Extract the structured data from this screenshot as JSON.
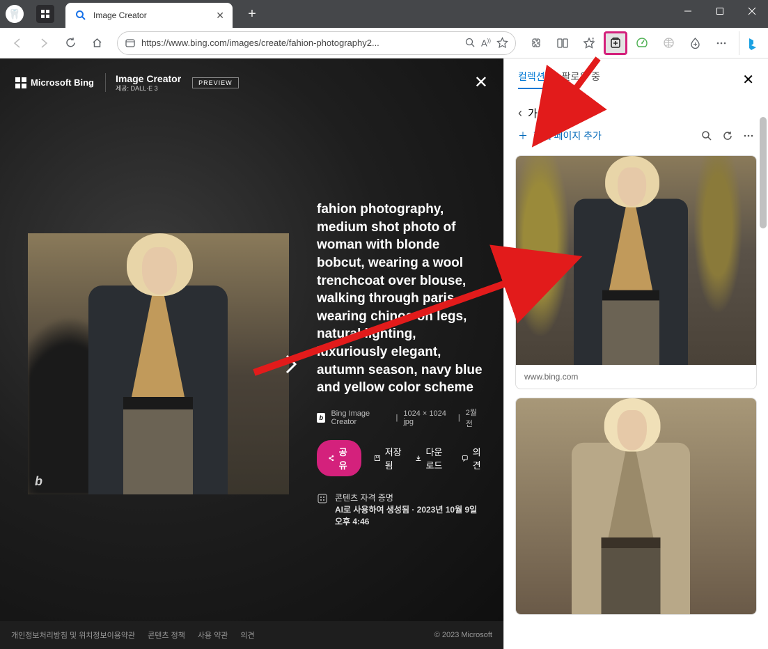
{
  "window": {
    "tab_title": "Image Creator",
    "url": "https://www.bing.com/images/create/fahion-photography2..."
  },
  "creator": {
    "brand_ms": "Microsoft Bing",
    "brand_ic": "Image Creator",
    "brand_sub": "제공: DALL·E 3",
    "preview_badge": "PREVIEW",
    "prompt": "fahion photography, medium shot photo of woman with blonde bobcut, wearing a wool trenchcoat over blouse, walking through paris, wearing chinos on legs, natural lighting, luxuriously elegant, autumn season, navy blue and yellow color scheme",
    "source": "Bing Image Creator",
    "dimensions": "1024 × 1024 jpg",
    "age": "2월 전",
    "share": "공유",
    "save": "저장됨",
    "download": "다운로드",
    "feedback": "의견",
    "credential1": "콘텐츠 자격 증명",
    "credential2": "AI로 사용하여 생성됨 · 2023년 10월 9일 오후 4:46",
    "footer_privacy": "개인정보처리방침 및 위치정보이용약관",
    "footer_content": "콘텐츠 정책",
    "footer_terms": "사용 약관",
    "footer_feedback": "의견",
    "footer_copyright": "© 2023 Microsoft"
  },
  "collections": {
    "tab_collections": "컬렉션",
    "tab_following": "팔로우 중",
    "title": "가을 패션",
    "add_page": "현재 페이지 추가",
    "card1_source": "www.bing.com"
  }
}
